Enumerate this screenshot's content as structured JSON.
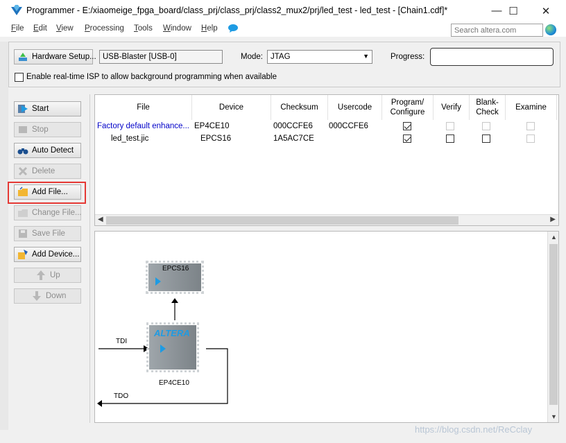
{
  "window": {
    "title": "Programmer - E:/xiaomeige_fpga_board/class_prj/class_prj/class2_mux2/prj/led_test - led_test - [Chain1.cdf]*",
    "minimize": "—",
    "maximize": "☐",
    "close": "✕"
  },
  "menu": {
    "items": [
      {
        "key": "F",
        "rest": "ile"
      },
      {
        "key": "E",
        "rest": "dit"
      },
      {
        "key": "V",
        "rest": "iew"
      },
      {
        "key": "P",
        "rest": "rocessing"
      },
      {
        "key": "T",
        "rest": "ools"
      },
      {
        "key": "W",
        "rest": "indow"
      },
      {
        "key": "H",
        "rest": "elp"
      }
    ],
    "search_placeholder": "Search altera.com"
  },
  "hardware": {
    "setup_label": "Hardware Setup...",
    "device": "USB-Blaster [USB-0]",
    "mode_label": "Mode:",
    "mode_value": "JTAG",
    "progress_label": "Progress:",
    "progress_fraction": 0,
    "isp_label": "Enable real-time ISP to allow background programming when available"
  },
  "sidebar": {
    "start": "Start",
    "stop": "Stop",
    "auto_detect": "Auto Detect",
    "delete": "Delete",
    "add_file": "Add File...",
    "change_file": "Change File...",
    "save_file": "Save File",
    "add_device": "Add Device...",
    "up": "Up",
    "down": "Down"
  },
  "table": {
    "headers": {
      "file": "File",
      "device": "Device",
      "checksum": "Checksum",
      "usercode": "Usercode",
      "program1": "Program/",
      "program2": "Configure",
      "verify": "Verify",
      "blank1": "Blank-",
      "blank2": "Check",
      "examine": "Examine"
    },
    "rows": [
      {
        "file": "Factory default enhance...",
        "device": "EP4CE10",
        "checksum": "000CCFE6",
        "usercode": "000CCFE6",
        "program": true,
        "verify": false,
        "blank": false,
        "examine": false
      },
      {
        "file": "led_test.jic",
        "device": "EPCS16",
        "checksum": "1A5AC7CE",
        "usercode": "",
        "program": true,
        "verify": false,
        "blank": false,
        "examine": false
      }
    ]
  },
  "diagram": {
    "flash_label": "EPCS16",
    "fpga_label": "EP4CE10",
    "fpga_logo": "ALTERA",
    "tdi": "TDI",
    "tdo": "TDO"
  },
  "colors": {
    "link_blue": "#0000c8",
    "accent_blue": "#1e9be3",
    "highlight_red": "#e53935"
  },
  "watermark": "https://blog.csdn.net/ReCclay"
}
